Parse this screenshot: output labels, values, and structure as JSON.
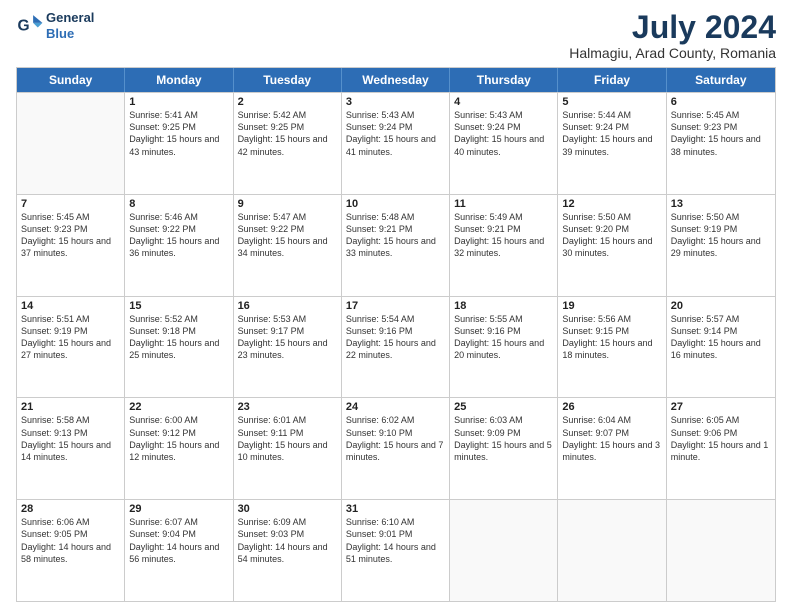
{
  "logo": {
    "line1": "General",
    "line2": "Blue"
  },
  "title": "July 2024",
  "subtitle": "Halmagiu, Arad County, Romania",
  "weekdays": [
    "Sunday",
    "Monday",
    "Tuesday",
    "Wednesday",
    "Thursday",
    "Friday",
    "Saturday"
  ],
  "weeks": [
    [
      {
        "day": "",
        "empty": true
      },
      {
        "day": "1",
        "sunrise": "5:41 AM",
        "sunset": "9:25 PM",
        "daylight": "15 hours and 43 minutes."
      },
      {
        "day": "2",
        "sunrise": "5:42 AM",
        "sunset": "9:25 PM",
        "daylight": "15 hours and 42 minutes."
      },
      {
        "day": "3",
        "sunrise": "5:43 AM",
        "sunset": "9:24 PM",
        "daylight": "15 hours and 41 minutes."
      },
      {
        "day": "4",
        "sunrise": "5:43 AM",
        "sunset": "9:24 PM",
        "daylight": "15 hours and 40 minutes."
      },
      {
        "day": "5",
        "sunrise": "5:44 AM",
        "sunset": "9:24 PM",
        "daylight": "15 hours and 39 minutes."
      },
      {
        "day": "6",
        "sunrise": "5:45 AM",
        "sunset": "9:23 PM",
        "daylight": "15 hours and 38 minutes."
      }
    ],
    [
      {
        "day": "7",
        "sunrise": "5:45 AM",
        "sunset": "9:23 PM",
        "daylight": "15 hours and 37 minutes."
      },
      {
        "day": "8",
        "sunrise": "5:46 AM",
        "sunset": "9:22 PM",
        "daylight": "15 hours and 36 minutes."
      },
      {
        "day": "9",
        "sunrise": "5:47 AM",
        "sunset": "9:22 PM",
        "daylight": "15 hours and 34 minutes."
      },
      {
        "day": "10",
        "sunrise": "5:48 AM",
        "sunset": "9:21 PM",
        "daylight": "15 hours and 33 minutes."
      },
      {
        "day": "11",
        "sunrise": "5:49 AM",
        "sunset": "9:21 PM",
        "daylight": "15 hours and 32 minutes."
      },
      {
        "day": "12",
        "sunrise": "5:50 AM",
        "sunset": "9:20 PM",
        "daylight": "15 hours and 30 minutes."
      },
      {
        "day": "13",
        "sunrise": "5:50 AM",
        "sunset": "9:19 PM",
        "daylight": "15 hours and 29 minutes."
      }
    ],
    [
      {
        "day": "14",
        "sunrise": "5:51 AM",
        "sunset": "9:19 PM",
        "daylight": "15 hours and 27 minutes."
      },
      {
        "day": "15",
        "sunrise": "5:52 AM",
        "sunset": "9:18 PM",
        "daylight": "15 hours and 25 minutes."
      },
      {
        "day": "16",
        "sunrise": "5:53 AM",
        "sunset": "9:17 PM",
        "daylight": "15 hours and 23 minutes."
      },
      {
        "day": "17",
        "sunrise": "5:54 AM",
        "sunset": "9:16 PM",
        "daylight": "15 hours and 22 minutes."
      },
      {
        "day": "18",
        "sunrise": "5:55 AM",
        "sunset": "9:16 PM",
        "daylight": "15 hours and 20 minutes."
      },
      {
        "day": "19",
        "sunrise": "5:56 AM",
        "sunset": "9:15 PM",
        "daylight": "15 hours and 18 minutes."
      },
      {
        "day": "20",
        "sunrise": "5:57 AM",
        "sunset": "9:14 PM",
        "daylight": "15 hours and 16 minutes."
      }
    ],
    [
      {
        "day": "21",
        "sunrise": "5:58 AM",
        "sunset": "9:13 PM",
        "daylight": "15 hours and 14 minutes."
      },
      {
        "day": "22",
        "sunrise": "6:00 AM",
        "sunset": "9:12 PM",
        "daylight": "15 hours and 12 minutes."
      },
      {
        "day": "23",
        "sunrise": "6:01 AM",
        "sunset": "9:11 PM",
        "daylight": "15 hours and 10 minutes."
      },
      {
        "day": "24",
        "sunrise": "6:02 AM",
        "sunset": "9:10 PM",
        "daylight": "15 hours and 7 minutes."
      },
      {
        "day": "25",
        "sunrise": "6:03 AM",
        "sunset": "9:09 PM",
        "daylight": "15 hours and 5 minutes."
      },
      {
        "day": "26",
        "sunrise": "6:04 AM",
        "sunset": "9:07 PM",
        "daylight": "15 hours and 3 minutes."
      },
      {
        "day": "27",
        "sunrise": "6:05 AM",
        "sunset": "9:06 PM",
        "daylight": "15 hours and 1 minute."
      }
    ],
    [
      {
        "day": "28",
        "sunrise": "6:06 AM",
        "sunset": "9:05 PM",
        "daylight": "14 hours and 58 minutes."
      },
      {
        "day": "29",
        "sunrise": "6:07 AM",
        "sunset": "9:04 PM",
        "daylight": "14 hours and 56 minutes."
      },
      {
        "day": "30",
        "sunrise": "6:09 AM",
        "sunset": "9:03 PM",
        "daylight": "14 hours and 54 minutes."
      },
      {
        "day": "31",
        "sunrise": "6:10 AM",
        "sunset": "9:01 PM",
        "daylight": "14 hours and 51 minutes."
      },
      {
        "day": "",
        "empty": true
      },
      {
        "day": "",
        "empty": true
      },
      {
        "day": "",
        "empty": true
      }
    ]
  ]
}
